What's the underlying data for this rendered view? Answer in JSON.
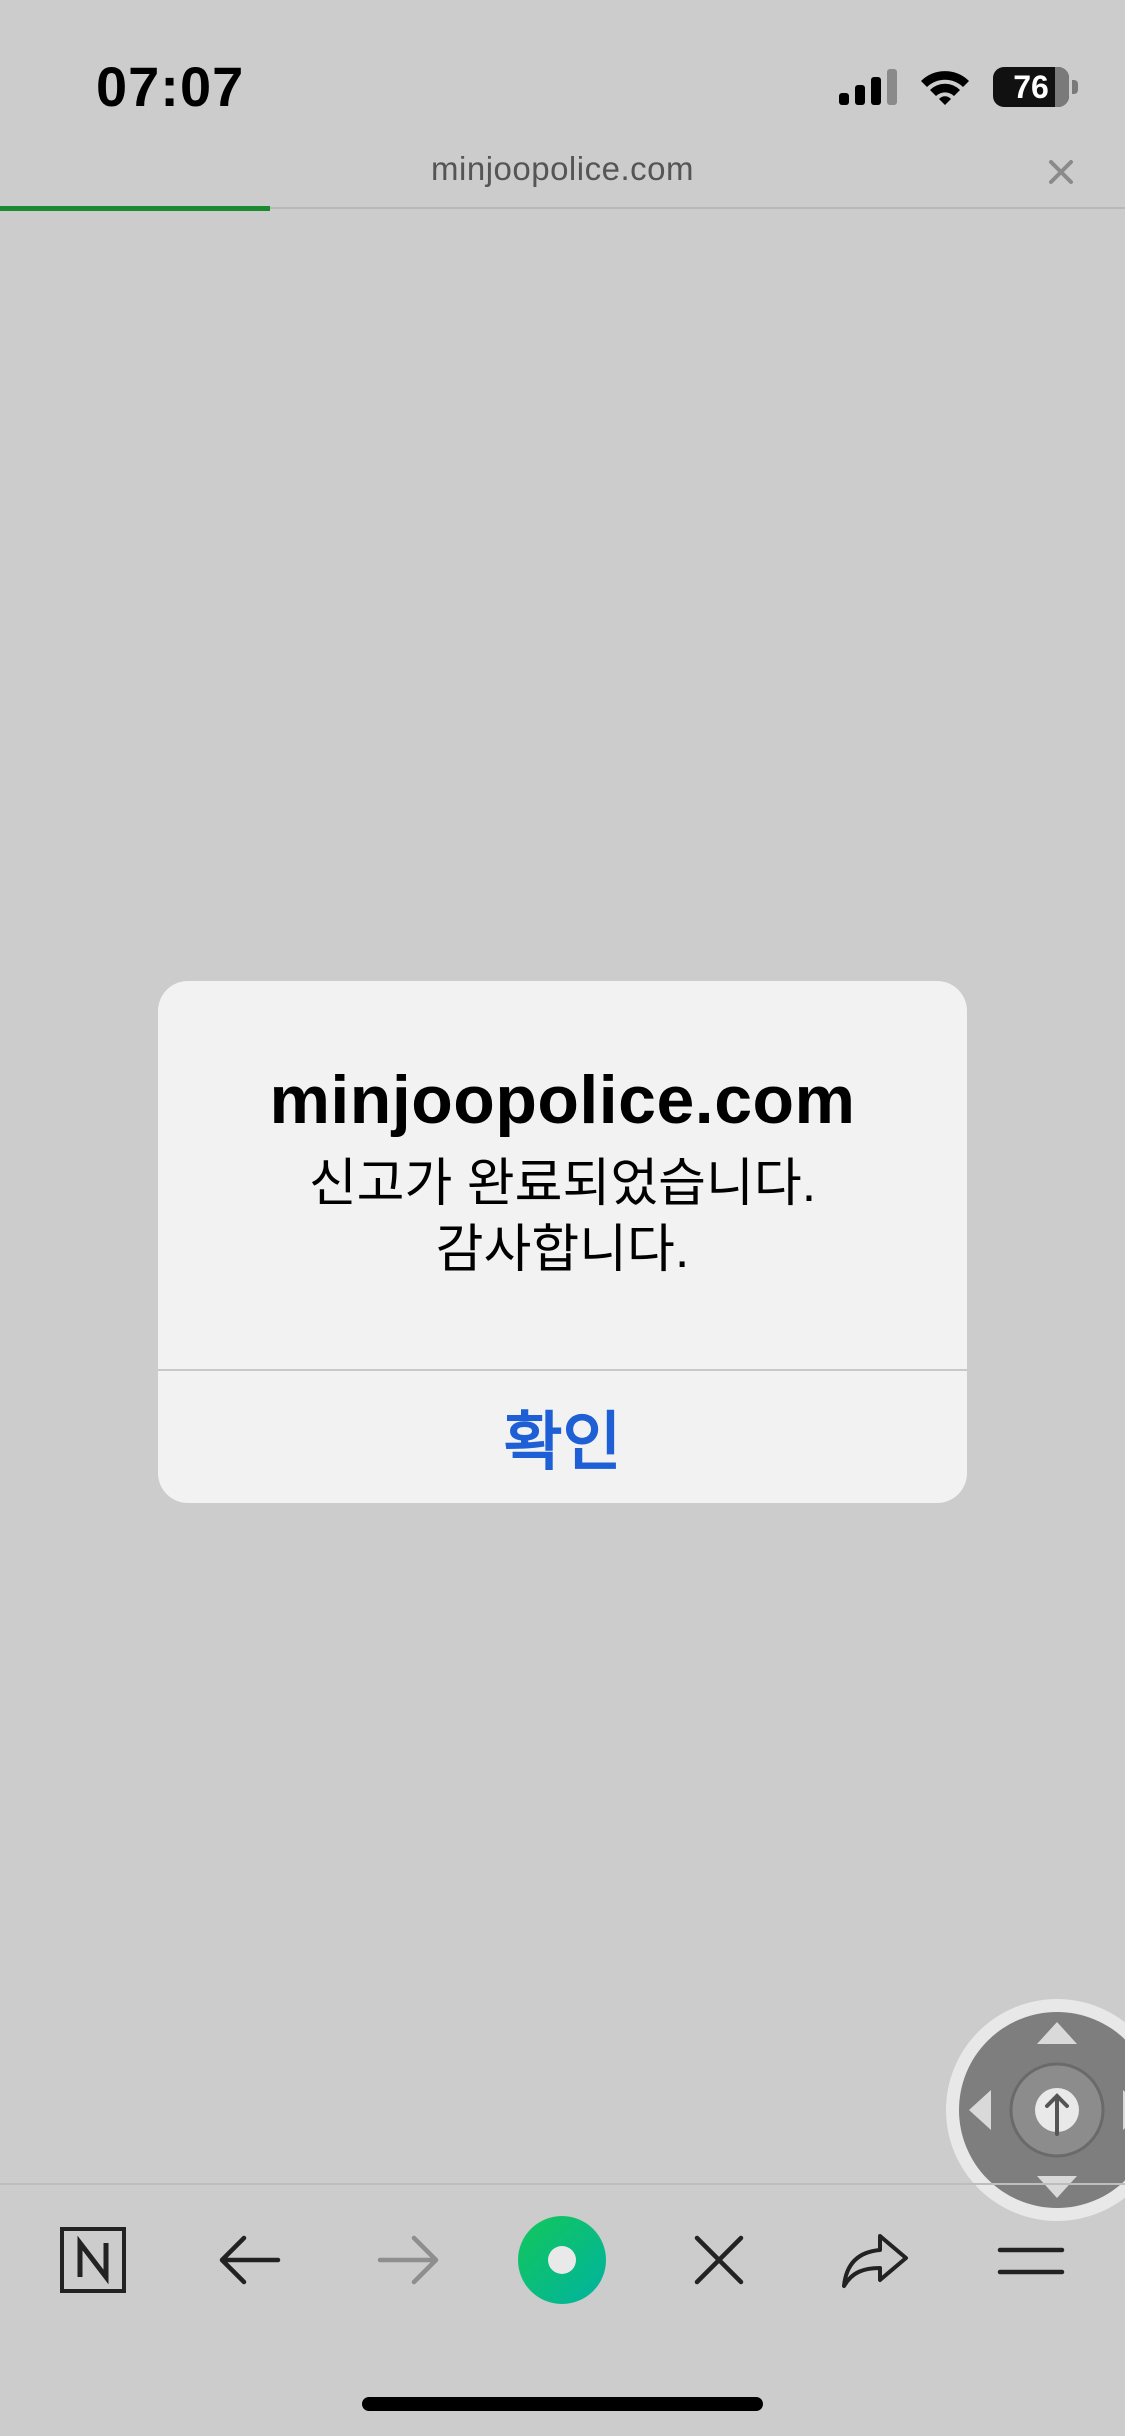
{
  "status_bar": {
    "time": "07:07",
    "battery": "76",
    "icons": [
      "signal-icon",
      "wifi-icon",
      "battery-icon"
    ]
  },
  "browser": {
    "url": "minjoopolice.com",
    "close_icon": "close-icon",
    "load_progress": 0.24,
    "accent_color": "#1b8a2e"
  },
  "alert": {
    "title": "minjoopolice.com",
    "message_line1": "신고가 완료되었습니다.",
    "message_line2": "감사합니다.",
    "confirm_label": "확인",
    "button_color": "#1f5fd6"
  },
  "toolbar": {
    "items": [
      "naver-home-icon",
      "back-arrow-icon",
      "forward-arrow-icon",
      "green-dot-icon",
      "close-icon",
      "share-icon",
      "menu-icon"
    ]
  }
}
